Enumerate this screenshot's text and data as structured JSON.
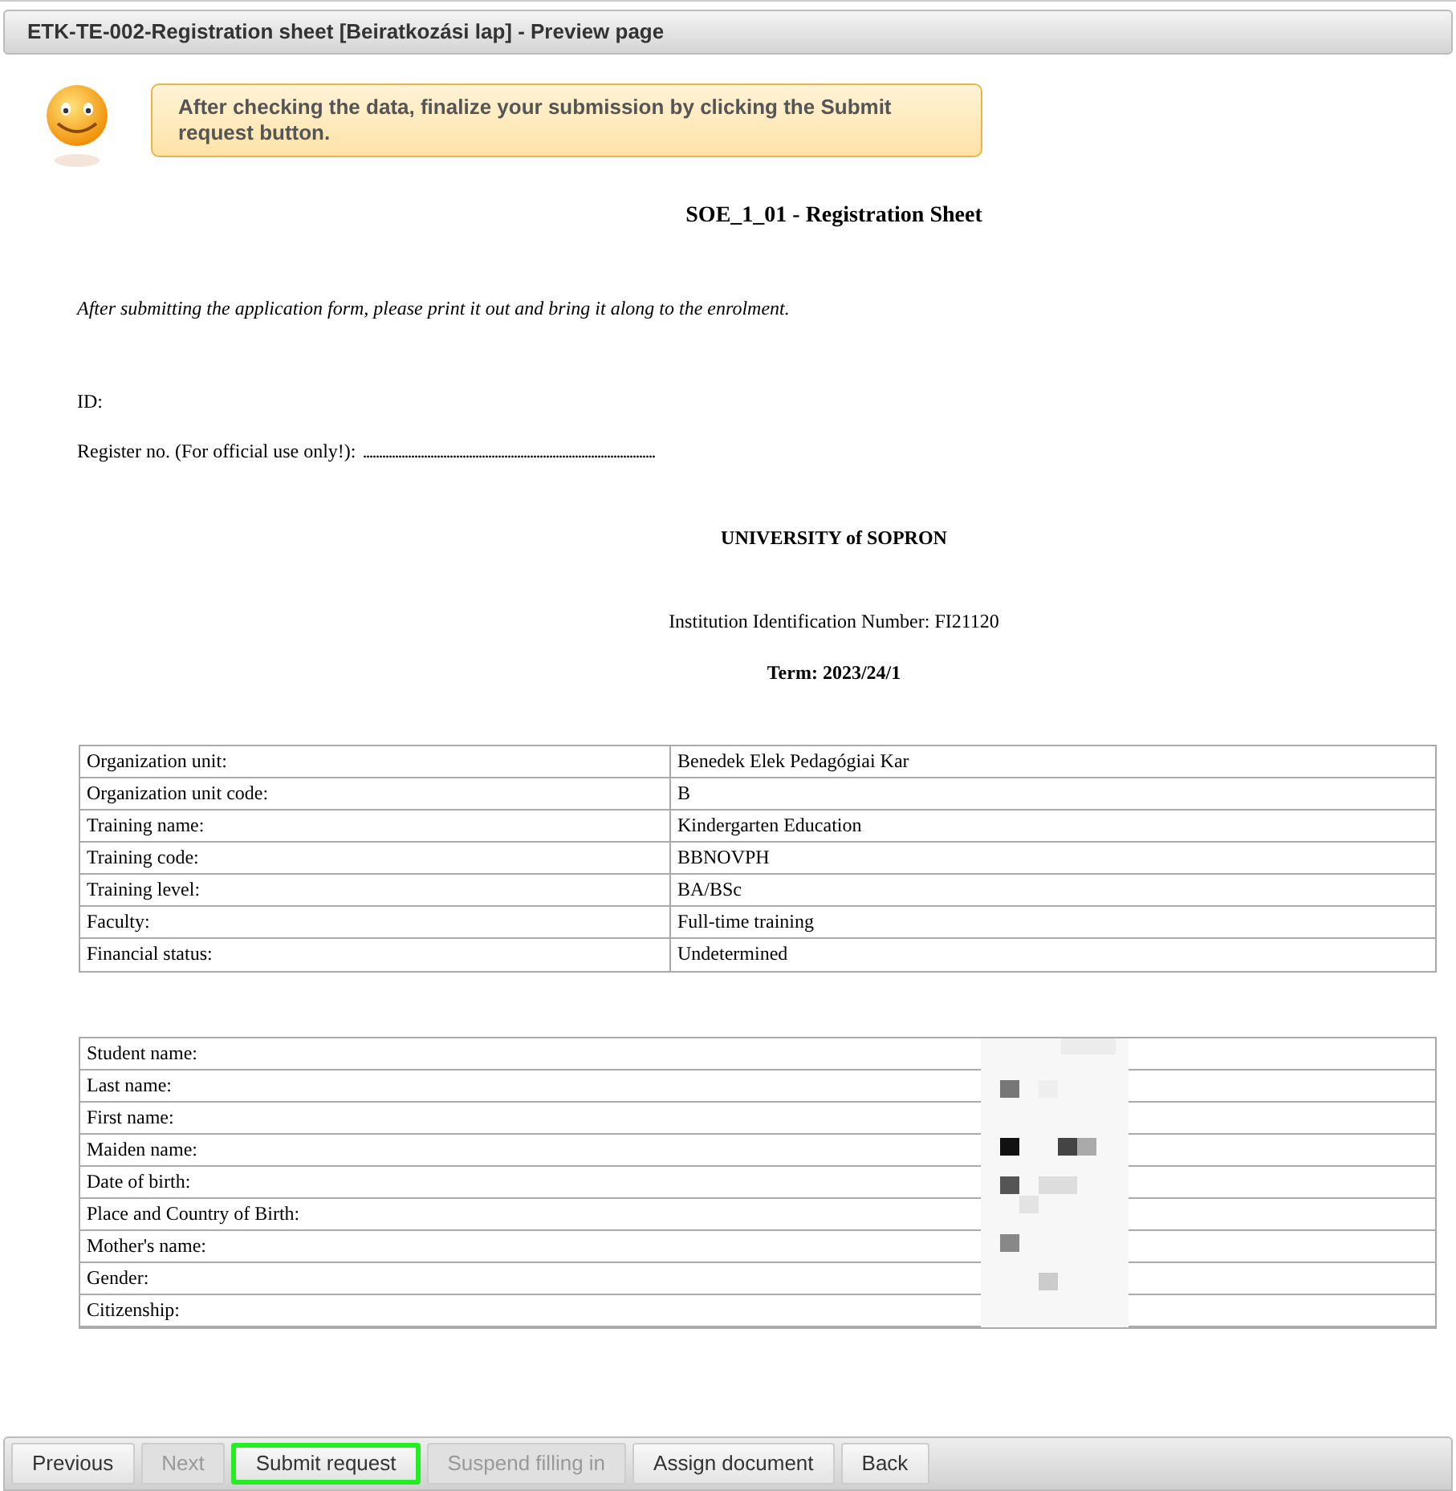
{
  "window": {
    "title": "ETK-TE-002-Registration sheet [Beiratkozási lap] - Preview page"
  },
  "hint": {
    "text": "After checking the data, finalize your submission by clicking the Submit request button."
  },
  "document": {
    "title": "SOE_1_01 - Registration Sheet",
    "note": "After submitting the application form, please print it out and bring it along to the enrolment.",
    "id_label": "ID:",
    "register_label": "Register no. (For official use only!):",
    "register_dots": "...........................................................................................",
    "institution": "UNIVERSITY of SOPRON",
    "institution_id": "Institution Identification Number: FI21120",
    "term": "Term: 2023/24/1",
    "training_table": [
      {
        "label": "Organization unit:",
        "value": "Benedek Elek Pedagógiai Kar"
      },
      {
        "label": "Organization unit code:",
        "value": "B"
      },
      {
        "label": "Training name:",
        "value": "Kindergarten Education"
      },
      {
        "label": "Training code:",
        "value": "BBNOVPH"
      },
      {
        "label": "Training level:",
        "value": "BA/BSc"
      },
      {
        "label": "Faculty:",
        "value": "Full-time training"
      },
      {
        "label": "Financial status:",
        "value": "Undetermined"
      }
    ],
    "student_table": [
      {
        "label": "Student name:"
      },
      {
        "label": "Last name:"
      },
      {
        "label": "First name:"
      },
      {
        "label": "Maiden name:"
      },
      {
        "label": "Date of birth:"
      },
      {
        "label": "Place and Country of Birth:"
      },
      {
        "label": "Mother's name:"
      },
      {
        "label": "Gender:"
      },
      {
        "label": "Citizenship:"
      }
    ]
  },
  "toolbar": [
    {
      "label": "Previous",
      "disabled": false,
      "highlighted": false
    },
    {
      "label": "Next",
      "disabled": true,
      "highlighted": false
    },
    {
      "label": "Submit request",
      "disabled": false,
      "highlighted": true
    },
    {
      "label": "Suspend filling in",
      "disabled": true,
      "highlighted": false
    },
    {
      "label": "Assign document",
      "disabled": false,
      "highlighted": false
    },
    {
      "label": "Back",
      "disabled": false,
      "highlighted": false
    }
  ]
}
